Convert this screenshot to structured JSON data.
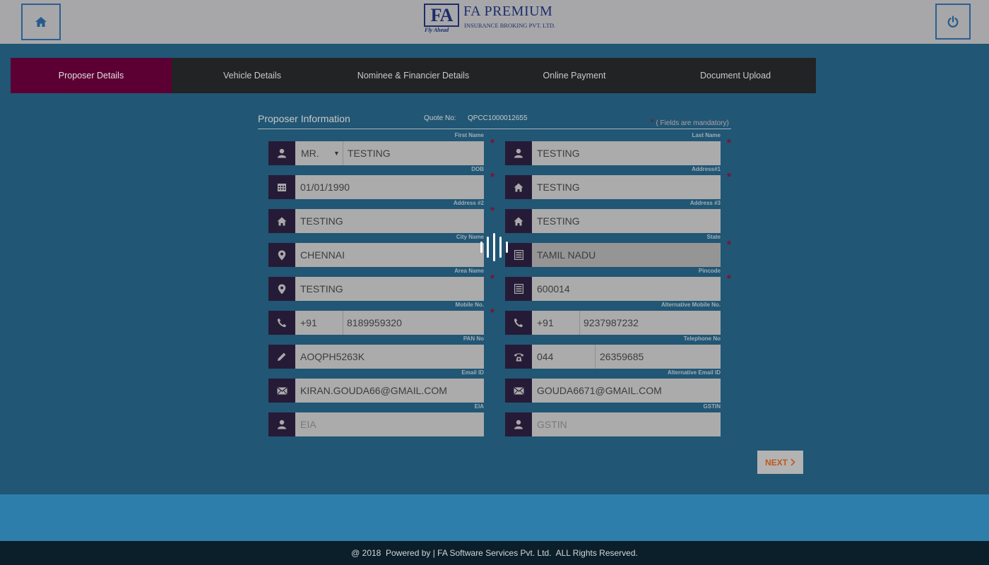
{
  "header": {
    "logo_mark": "FA",
    "logo_tagline": "Fly Ahead",
    "logo_name": "FA PREMIUM",
    "logo_subtitle": "INSURANCE BROKING PVT. LTD.",
    "home_icon": "home-icon",
    "power_icon": "power-icon"
  },
  "tabs": [
    {
      "label": "Proposer Details",
      "active": true
    },
    {
      "label": "Vehicle Details",
      "active": false
    },
    {
      "label": "Nominee & Financier Details",
      "active": false
    },
    {
      "label": "Online Payment",
      "active": false
    },
    {
      "label": "Document Upload",
      "active": false
    }
  ],
  "form": {
    "title": "Proposer Information",
    "quote_label": "Quote No:",
    "quote_value": "QPCC1000012655",
    "mandatory_note": "( Fields are mandatory)",
    "fields": {
      "first_name": {
        "label": "First Name",
        "salutation": "MR.",
        "value": "TESTING",
        "icon": "user-icon"
      },
      "last_name": {
        "label": "Last Name",
        "value": "TESTING",
        "icon": "user-icon"
      },
      "dob": {
        "label": "DOB",
        "value": "01/01/1990",
        "icon": "calendar-icon"
      },
      "address1": {
        "label": "Address#1",
        "value": "TESTING",
        "icon": "home-icon"
      },
      "address2": {
        "label": "Address #2",
        "value": "TESTING",
        "icon": "home-icon"
      },
      "address3": {
        "label": "Address #3",
        "value": "TESTING",
        "icon": "home-icon"
      },
      "city": {
        "label": "City Name",
        "value": "CHENNAI",
        "icon": "map-pin-icon"
      },
      "state": {
        "label": "State",
        "value": "TAMIL NADU",
        "icon": "list-icon"
      },
      "area": {
        "label": "Area Name",
        "value": "TESTING",
        "icon": "map-pin-icon"
      },
      "pincode": {
        "label": "Pincode",
        "value": "600014",
        "icon": "list-icon"
      },
      "mobile": {
        "label": "Mobile No.",
        "code": "+91",
        "value": "8189959320",
        "icon": "phone-icon"
      },
      "alt_mobile": {
        "label": "Alternative Mobile No.",
        "code": "+91",
        "value": "9237987232",
        "icon": "phone-icon"
      },
      "pan": {
        "label": "PAN No",
        "value": "AOQPH5263K",
        "icon": "pencil-icon"
      },
      "telephone": {
        "label": "Telephone No",
        "code": "044",
        "value": "26359685",
        "icon": "telephone-icon"
      },
      "email": {
        "label": "Email ID",
        "value": "KIRAN.GOUDA66@GMAIL.COM",
        "icon": "envelope-icon"
      },
      "alt_email": {
        "label": "Alternative Email ID",
        "value": "GOUDA6671@GMAIL.COM",
        "icon": "envelope-icon"
      },
      "eia": {
        "label": "EIA",
        "placeholder": "EIA",
        "icon": "user-icon"
      },
      "gstin": {
        "label": "GSTIN",
        "placeholder": "GSTIN",
        "icon": "user-icon"
      }
    },
    "next_label": "NEXT"
  },
  "footer": {
    "text": "@ 2018  Powered by | FA Software Services Pvt. Ltd.  ALL Rights Reserved."
  },
  "colors": {
    "page_bg": "#215674",
    "header_bg": "#a7a7a9",
    "tab_bar_bg": "#222324",
    "tab_active_bg": "#5c0033",
    "icon_bg": "#261b37",
    "field_bg": "#ababab",
    "required_star": "#8a0a2a",
    "footer_bg": "#0b1f2b",
    "band_bg": "#2e7eac"
  }
}
